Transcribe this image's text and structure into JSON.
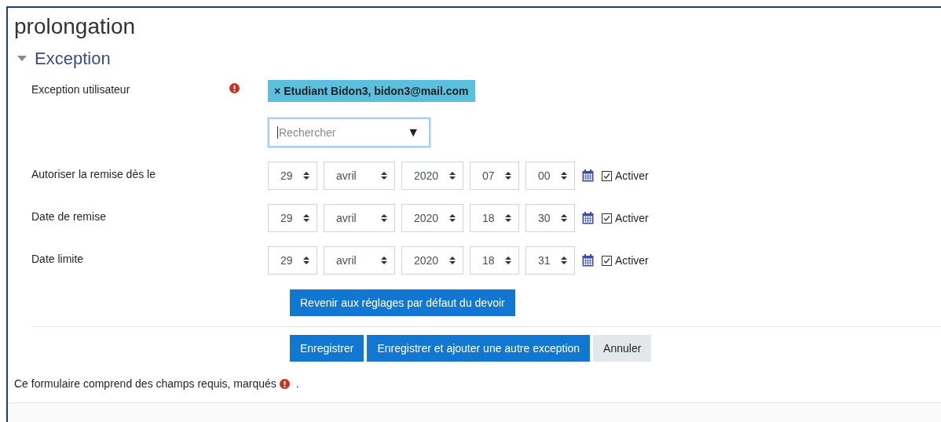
{
  "heading": "prolongation",
  "section": {
    "title": "Exception",
    "expanded": true
  },
  "user_field": {
    "label": "Exception utilisateur",
    "required": true,
    "chips": [
      {
        "remove": "×",
        "text": "Etudiant Bidon3, bidon3@mail.com"
      }
    ],
    "search": {
      "placeholder": "Rechercher",
      "arrow": "▼"
    }
  },
  "date_fields": [
    {
      "label": "Autoriser la remise dès le",
      "selects": [
        "29",
        "avril",
        "2020",
        "07",
        "00"
      ],
      "enable_label": "Activer",
      "checked": true
    },
    {
      "label": "Date de remise",
      "selects": [
        "29",
        "avril",
        "2020",
        "18",
        "30"
      ],
      "enable_label": "Activer",
      "checked": true
    },
    {
      "label": "Date limite",
      "selects": [
        "29",
        "avril",
        "2020",
        "18",
        "31"
      ],
      "enable_label": "Activer",
      "checked": true
    }
  ],
  "reset_button": "Revenir aux réglages par défaut du devoir",
  "buttons": [
    {
      "label": "Enregistrer",
      "kind": "primary"
    },
    {
      "label": "Enregistrer et ajouter une autre exception",
      "kind": "primary"
    },
    {
      "label": "Annuler",
      "kind": "secondary"
    }
  ],
  "footer_note": {
    "text": "Ce formulaire comprend des champs requis, marqués",
    "end": "."
  }
}
